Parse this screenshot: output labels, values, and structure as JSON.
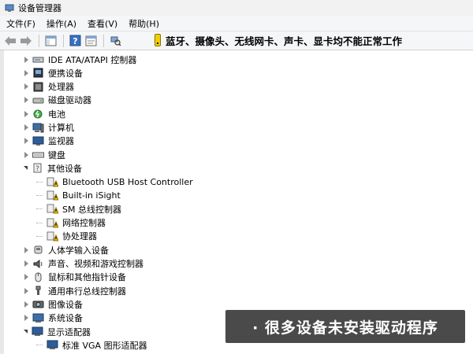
{
  "window": {
    "title": "设备管理器"
  },
  "menu": [
    "文件(F)",
    "操作(A)",
    "查看(V)",
    "帮助(H)"
  ],
  "notice": "蓝牙、摄像头、无线网卡、声卡、显卡均不能正常工作",
  "tree": [
    {
      "label": "IDE ATA/ATAPI 控制器",
      "icon": "ide-controller-icon",
      "state": "collapsed"
    },
    {
      "label": "便携设备",
      "icon": "portable-device-icon",
      "state": "collapsed"
    },
    {
      "label": "处理器",
      "icon": "processor-icon",
      "state": "collapsed"
    },
    {
      "label": "磁盘驱动器",
      "icon": "disk-drive-icon",
      "state": "collapsed"
    },
    {
      "label": "电池",
      "icon": "battery-icon",
      "state": "collapsed"
    },
    {
      "label": "计算机",
      "icon": "computer-icon",
      "state": "collapsed"
    },
    {
      "label": "监视器",
      "icon": "monitor-icon",
      "state": "collapsed"
    },
    {
      "label": "键盘",
      "icon": "keyboard-icon",
      "state": "collapsed"
    },
    {
      "label": "其他设备",
      "icon": "other-devices-icon",
      "state": "expanded"
    },
    {
      "label": "Bluetooth USB Host Controller",
      "icon": "unknown-device-warning-icon",
      "state": "child"
    },
    {
      "label": "Built-in iSight",
      "icon": "unknown-device-warning-icon",
      "state": "child"
    },
    {
      "label": "SM 总线控制器",
      "icon": "unknown-device-warning-icon",
      "state": "child"
    },
    {
      "label": "网络控制器",
      "icon": "unknown-device-warning-icon",
      "state": "child"
    },
    {
      "label": "协处理器",
      "icon": "unknown-device-warning-icon",
      "state": "child"
    },
    {
      "label": "人体学输入设备",
      "icon": "hid-icon",
      "state": "collapsed"
    },
    {
      "label": "声音、视频和游戏控制器",
      "icon": "sound-icon",
      "state": "collapsed"
    },
    {
      "label": "鼠标和其他指针设备",
      "icon": "mouse-icon",
      "state": "collapsed"
    },
    {
      "label": "通用串行总线控制器",
      "icon": "usb-icon",
      "state": "collapsed"
    },
    {
      "label": "图像设备",
      "icon": "imaging-device-icon",
      "state": "collapsed"
    },
    {
      "label": "系统设备",
      "icon": "system-device-icon",
      "state": "collapsed"
    },
    {
      "label": "显示适配器",
      "icon": "display-adapter-icon",
      "state": "expanded"
    },
    {
      "label": "标准 VGA 图形适配器",
      "icon": "vga-adapter-icon",
      "state": "child"
    }
  ],
  "caption": "· 很多设备未安装驱动程序"
}
